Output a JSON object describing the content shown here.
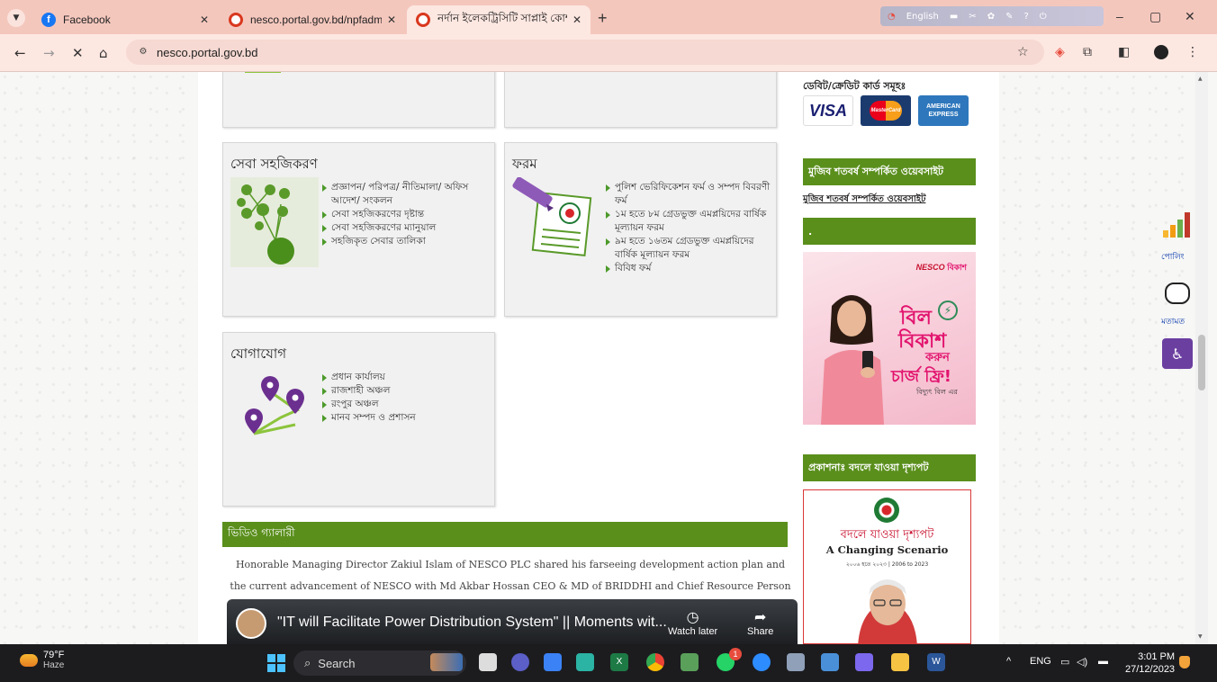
{
  "browser": {
    "tabs": [
      {
        "title": "Facebook",
        "favicon": "facebook-icon",
        "active": false
      },
      {
        "title": "nesco.portal.gov.bd/npfadmin/",
        "favicon": "gov-icon",
        "active": false
      },
      {
        "title": "নর্দান ইলেকট্রিসিটি সাপ্লাই কোম্প",
        "favicon": "gov-icon",
        "active": true
      }
    ],
    "new_tab": "+",
    "extension_text": "English",
    "url": "nesco.portal.gov.bd",
    "window_controls": {
      "minimize": "–",
      "restore": "▢",
      "close": "✕"
    }
  },
  "page": {
    "cards": [
      {
        "title": "সেবা সহজিকরণ",
        "icon": "service-tree-icon",
        "items": [
          "প্রজ্ঞাপন/ পরিপত্র/ নীতিমালা/ অফিস আদেশ/ সংকলন",
          "সেবা সহজিকরণের দৃষ্টান্ত",
          "সেবা সহজিকরণের ম্যানুয়াল",
          "সহজিকৃত সেবার তালিকা"
        ]
      },
      {
        "title": "ফরম",
        "icon": "form-pen-icon",
        "items": [
          "পুলিশ ভেরিফিকেশন ফর্ম ও সম্পদ বিবরণী ফর্ম",
          "১ম হতে ৮ম গ্রেডভুক্ত এমপ্লয়িদের বার্ষিক মূল্যায়ন ফরম",
          "৯ম হতে ১৬তম গ্রেডভুক্ত এমপ্লয়িদের বার্ষিক মূল্যায়ন ফরম",
          "বিবিধ ফর্ম"
        ]
      },
      {
        "title": "যোগাযোগ",
        "icon": "location-pins-icon",
        "items": [
          "প্রধান কার্যালয়",
          "রাজশাহী অঞ্চল",
          "রংপুর অঞ্চল",
          "মানব সম্পদ ও প্রশাসন"
        ]
      }
    ],
    "video_gallery": {
      "heading": "ভিডিও গ্যালারী",
      "caption": "Honorable Managing Director Zakiul Islam of NESCO PLC shared his farseeing development action plan and the current advancement of NESCO with Md Akbar Hossan CEO & MD of BRIDDHI and Chief Resource Person",
      "video_title": "\"IT will Facilitate Power Distribution System\" || Moments wit...",
      "watch_later": "Watch later",
      "share": "Share"
    },
    "sidebar": {
      "cards_label": "ডেবিট/ক্রেডিট কার্ড সমূহঃ",
      "card_brands": [
        "VISA",
        "MasterCard",
        "AMERICAN EXPRESS"
      ],
      "mujib_heading": "মুজিব শতবর্ষ সম্পর্কিত ওয়েবসাইট",
      "mujib_link": "মুজিব শতবর্ষ সম্পর্কিত ওয়েবসাইট",
      "dot_heading": ".",
      "promo": {
        "brand_nesco": "NESCO",
        "brand_bkash": "বিকাশ",
        "line1": "বিল",
        "line2": "বিকাশ",
        "line3": "করুন",
        "line4": "চার্জ ফ্রি!",
        "line5": "বিদ্যুৎ বিল এর"
      },
      "publication_heading": "প্রকাশনাঃ বদলে যাওয়া দৃশ্যপট",
      "book": {
        "title_bn": "বদলে যাওয়া দৃশ্যপট",
        "title_en": "A Changing Scenario",
        "years": "২০০৬ হতে ২০২৩ | 2006 to 2023"
      }
    },
    "floating": {
      "poll_label": "পোলিং",
      "opinion_label": "মতামত"
    }
  },
  "taskbar": {
    "temperature": "79°F",
    "weather": "Haze",
    "search_placeholder": "Search",
    "tray_lang": "ENG",
    "time": "3:01 PM",
    "date": "27/12/2023",
    "whatsapp_badge": "1"
  },
  "colors": {
    "green": "#5a8f1c",
    "tabbar": "#f4c7bd",
    "accent_purple": "#6b3fa0"
  }
}
